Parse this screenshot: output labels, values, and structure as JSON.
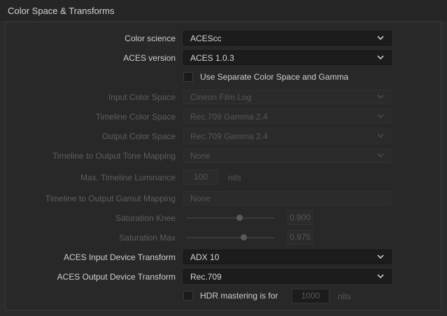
{
  "header": {
    "title": "Color Space & Transforms"
  },
  "rows": {
    "color_science": {
      "label": "Color science",
      "value": "ACEScc"
    },
    "aces_version": {
      "label": "ACES version",
      "value": "ACES 1.0.3"
    },
    "separate_cs_gamma": {
      "label": "Use Separate Color Space and Gamma",
      "checked": false
    },
    "input_color_space": {
      "label": "Input Color Space",
      "value": "Cineon Film Log"
    },
    "timeline_color_space": {
      "label": "Timeline Color Space",
      "value": "Rec.709 Gamma 2.4"
    },
    "output_color_space": {
      "label": "Output Color Space",
      "value": "Rec.709 Gamma 2.4"
    },
    "tone_mapping": {
      "label": "Timeline to Output Tone Mapping",
      "value": "None"
    },
    "max_luminance": {
      "label": "Max. Timeline Luminance",
      "value": "100",
      "unit": "nits"
    },
    "gamut_mapping": {
      "label": "Timeline to Output Gamut Mapping",
      "value": "None"
    },
    "saturation_knee": {
      "label": "Saturation Knee",
      "value": "0.900",
      "level": 0.9
    },
    "saturation_max": {
      "label": "Saturation Max",
      "value": "0.975",
      "level": 0.975
    },
    "aces_idt": {
      "label": "ACES Input Device Transform",
      "value": "ADX 10"
    },
    "aces_odt": {
      "label": "ACES Output Device Transform",
      "value": "Rec.709"
    },
    "hdr_mastering": {
      "label": "HDR mastering is for",
      "checked": false,
      "value": "1000",
      "unit": "nits"
    }
  },
  "icons": {
    "dropdown": "chevron-down-icon"
  }
}
